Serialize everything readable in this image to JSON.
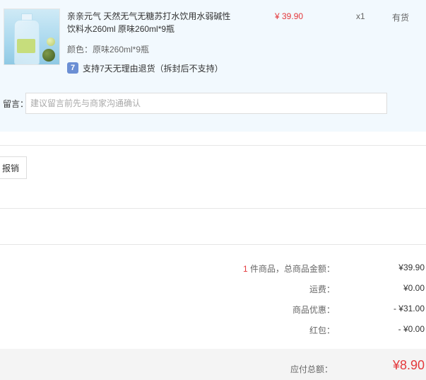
{
  "item": {
    "title_line1": "亲亲元气 天然无气无糖苏打水饮用水弱碱性",
    "title_line2": "饮料水260ml 原味260ml*9瓶",
    "price": "¥ 39.90",
    "quantity": "x1",
    "stock": "有货",
    "spec": "颜色：原味260ml*9瓶",
    "return_policy": "支持7天无理由退货（拆封后不支持）",
    "return_icon": "7"
  },
  "memo": {
    "label": "留言：",
    "placeholder": "建议留言前先与商家沟通确认"
  },
  "invoice": {
    "button_label": "报销"
  },
  "summary": {
    "count": "1",
    "items_label": " 件商品，总商品金额：",
    "items_total": "¥39.90",
    "shipping_label": "运费：",
    "shipping_value": "¥0.00",
    "discount_label": "商品优惠：",
    "discount_value": "- ¥31.00",
    "hongbao_label": "红包：",
    "hongbao_value": "- ¥0.00",
    "payable_label": "应付总额：",
    "payable_value": "¥8.90"
  },
  "colors": {
    "accent": "#e4393c",
    "panel_bg": "#f2f9fe",
    "return_icon_bg": "#6b8fd4"
  }
}
